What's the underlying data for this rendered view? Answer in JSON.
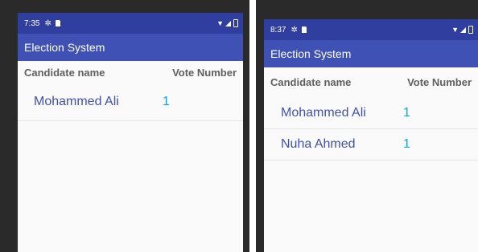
{
  "left": {
    "status_time": "7:35",
    "title": "Election System",
    "header": {
      "name": "Candidate name",
      "votes": "Vote Number"
    },
    "rows": [
      {
        "name": "Mohammed Ali",
        "votes": "1"
      }
    ]
  },
  "right": {
    "status_time": "8:37",
    "title": "Election System",
    "header": {
      "name": "Candidate name",
      "votes": "Vote Number"
    },
    "rows": [
      {
        "name": "Mohammed Ali",
        "votes": "1"
      },
      {
        "name": "Nuha Ahmed",
        "votes": "1"
      }
    ]
  },
  "icons": {
    "status": [
      "settings-gear-icon",
      "sd-card-icon",
      "wifi-icon",
      "signal-icon",
      "battery-icon"
    ]
  },
  "colors": {
    "appbar": "#3f51b5",
    "statusbar": "#303f9f",
    "name_text": "#3f51b5",
    "vote_text": "#03a9f4"
  }
}
